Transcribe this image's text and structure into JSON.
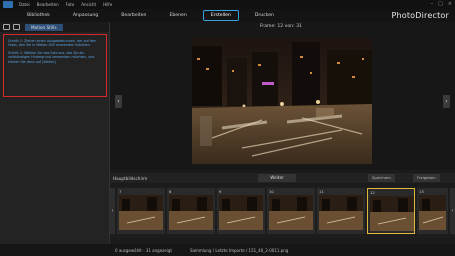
{
  "app": {
    "brand": "PhotoDirector"
  },
  "menu": {
    "items": [
      "Datei",
      "Bearbeiten",
      "Foto",
      "Ansicht",
      "Hilfe"
    ]
  },
  "tabs": [
    {
      "label": "Bibliothek",
      "active": false
    },
    {
      "label": "Anpassung",
      "active": false
    },
    {
      "label": "Bearbeiten",
      "active": false
    },
    {
      "label": "Ebenen",
      "active": false
    },
    {
      "label": "Erstellen",
      "active": true
    },
    {
      "label": "Drucken",
      "active": false
    }
  ],
  "left_panel": {
    "title": "Motion Stills",
    "instructions": [
      "Schritt 1: Ziehen einen Ausgabebrunnen, der auf den Fotos, den Sie in Motion Still verwenden möchten.",
      "Schritt 2: Wählen Sie das Foto aus, das Sie als vollständigen Hintergrund verwenden möchten, und klicken Sie dann auf [Weiter]."
    ]
  },
  "preview": {
    "frame_label": "Frame: 12 von: 31"
  },
  "film_bar": {
    "folder": "Hauptbildschirm",
    "wide_button": "Weiter",
    "save_button": "Speichern",
    "release_button": "Freigeben"
  },
  "filmstrip": {
    "thumbs": [
      {
        "num": "7",
        "selected": false
      },
      {
        "num": "8",
        "selected": false
      },
      {
        "num": "9",
        "selected": false
      },
      {
        "num": "10",
        "selected": false
      },
      {
        "num": "11",
        "selected": false
      },
      {
        "num": "12",
        "selected": true
      },
      {
        "num": "13",
        "selected": false
      }
    ]
  },
  "status": {
    "left": "0 ausgewählt - 31 angezeigt",
    "right": "Sammlung / Letzte Importe / 151_46_2-0011.png"
  },
  "colors": {
    "accent": "#3aa0e0",
    "highlight": "#d42a2a",
    "selection": "#e0b83a",
    "info_text": "#5aa6e6"
  }
}
